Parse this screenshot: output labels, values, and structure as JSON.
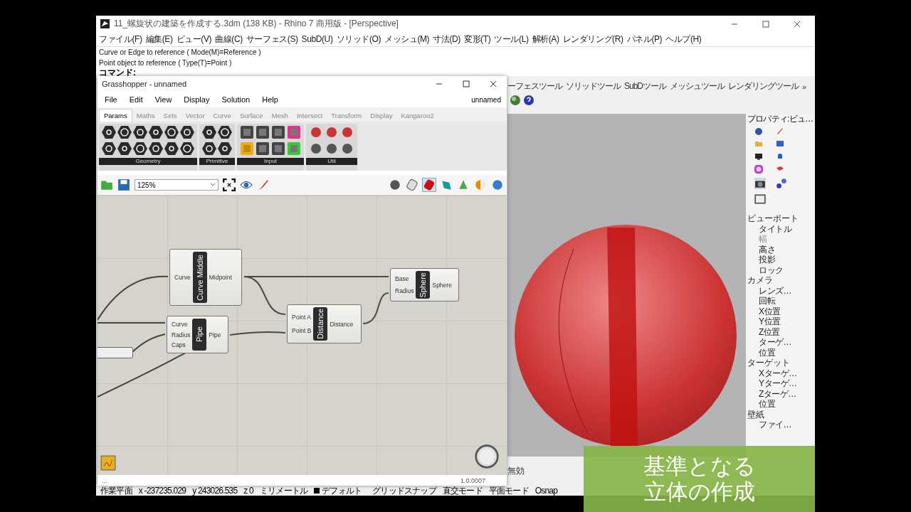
{
  "rhino": {
    "title": "11_螺旋状の建築を作成する.3dm (138 KB) - Rhino 7 商用版 - [Perspective]",
    "menu": [
      "ファイル(F)",
      "編集(E)",
      "ビュー(V)",
      "曲線(C)",
      "サーフェス(S)",
      "SubD(U)",
      "ソリッド(O)",
      "メッシュ(M)",
      "寸法(D)",
      "変形(T)",
      "ツール(L)",
      "解析(A)",
      "レンダリング(R)",
      "パネル(P)",
      "ヘルプ(H)"
    ],
    "command_history": [
      "Curve or Edge to reference ( Mode(M)=Reference )",
      "Point object to reference ( Type(T)=Point )"
    ],
    "command_prompt": "コマンド:",
    "toolbar_tabs": [
      "ーフェスツール",
      "ソリッドツール",
      "SubDツール",
      "メッシュツール",
      "レンダリングツール"
    ],
    "toolbar_more": "»",
    "properties": {
      "title": "プロパティ:ビュ…",
      "sections": [
        {
          "label": "ビューポート",
          "children": [
            {
              "label": "タイトル",
              "disabled": false
            },
            {
              "label": "幅",
              "disabled": true
            },
            {
              "label": "高さ",
              "disabled": false
            },
            {
              "label": "投影",
              "disabled": false
            },
            {
              "label": "ロック",
              "disabled": false
            }
          ]
        },
        {
          "label": "カメラ",
          "children": [
            {
              "label": "レンズ…",
              "disabled": false
            },
            {
              "label": "回転",
              "disabled": false
            },
            {
              "label": "X位置",
              "disabled": false
            },
            {
              "label": "Y位置",
              "disabled": false
            },
            {
              "label": "Z位置",
              "disabled": false
            },
            {
              "label": "ターゲ…",
              "disabled": false
            },
            {
              "label": "位置",
              "disabled": false
            }
          ]
        },
        {
          "label": "ターゲット",
          "children": [
            {
              "label": "Xターゲ…",
              "disabled": false
            },
            {
              "label": "Yターゲ…",
              "disabled": false
            },
            {
              "label": "Zターゲ…",
              "disabled": false
            },
            {
              "label": "位置",
              "disabled": false
            }
          ]
        },
        {
          "label": "壁紙",
          "children": [
            {
              "label": "ファイ…",
              "disabled": false
            }
          ]
        }
      ]
    },
    "viewport_note": "無効",
    "status_bar": [
      "作業平面",
      "x -237235.029",
      "y 243026.535",
      "z 0",
      "ミリメートル",
      "デフォルト",
      "グリッドスナップ",
      "直交モード",
      "平面モード",
      "Osnap"
    ]
  },
  "grasshopper": {
    "title": "Grasshopper - unnamed",
    "menu": [
      "File",
      "Edit",
      "View",
      "Display",
      "Solution",
      "Help"
    ],
    "document": "unnamed",
    "tabs": [
      {
        "label": "Params",
        "selected": true
      },
      {
        "label": "Maths",
        "selected": false
      },
      {
        "label": "Sets",
        "selected": false
      },
      {
        "label": "Vector",
        "selected": false
      },
      {
        "label": "Curve",
        "selected": false
      },
      {
        "label": "Surface",
        "selected": false
      },
      {
        "label": "Mesh",
        "selected": false
      },
      {
        "label": "Intersect",
        "selected": false
      },
      {
        "label": "Transform",
        "selected": false
      },
      {
        "label": "Display",
        "selected": false
      },
      {
        "label": "Kangaroo2",
        "selected": false
      }
    ],
    "groups": [
      "Geometry",
      "Primitive",
      "Input",
      "Util"
    ],
    "zoom": "125%",
    "nodes": [
      {
        "name": "Curve Middle",
        "inputs": [
          "Curve"
        ],
        "outputs": [
          "Midpoint"
        ]
      },
      {
        "name": "Pipe",
        "inputs": [
          "Curve",
          "Radius",
          "Caps"
        ],
        "outputs": [
          "Pipe"
        ]
      },
      {
        "name": "Distance",
        "inputs": [
          "Point A",
          "Point B"
        ],
        "outputs": [
          "Distance"
        ]
      },
      {
        "name": "Sphere",
        "inputs": [
          "Base",
          "Radius"
        ],
        "outputs": [
          "Sphere"
        ]
      }
    ],
    "footer_left": "...",
    "version": "1.0.0007"
  },
  "caption": [
    "基準となる",
    "立体の作成"
  ]
}
